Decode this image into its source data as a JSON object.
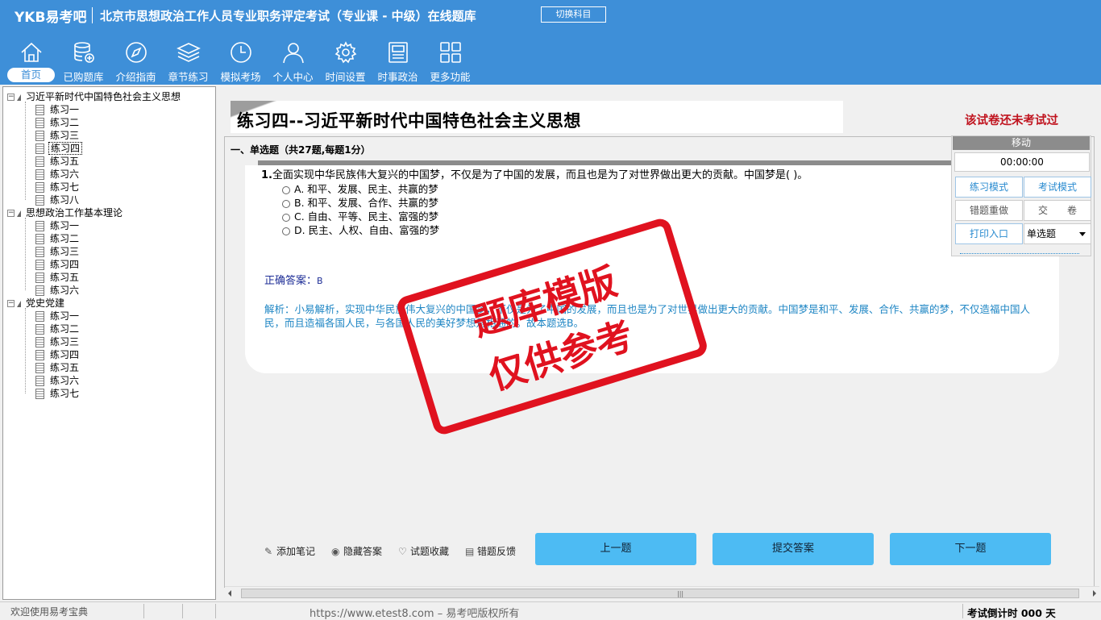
{
  "header": {
    "brand": "YKB易考吧",
    "title": "北京市思想政治工作人员专业职务评定考试（专业课 - 中级）在线题库",
    "switch_label": "切换科目",
    "nav": [
      {
        "label": "首页",
        "icon": "home-icon",
        "active": true
      },
      {
        "label": "已购题库",
        "icon": "database-add-icon"
      },
      {
        "label": "介绍指南",
        "icon": "compass-icon"
      },
      {
        "label": "章节练习",
        "icon": "layers-icon"
      },
      {
        "label": "模拟考场",
        "icon": "clock-icon"
      },
      {
        "label": "个人中心",
        "icon": "user-icon"
      },
      {
        "label": "时间设置",
        "icon": "gear-icon"
      },
      {
        "label": "时事政治",
        "icon": "news-icon"
      },
      {
        "label": "更多功能",
        "icon": "grid-icon"
      }
    ]
  },
  "tree": {
    "groups": [
      {
        "label": "习近平新时代中国特色社会主义思想",
        "items": [
          "练习一",
          "练习二",
          "练习三",
          "练习四",
          "练习五",
          "练习六",
          "练习七",
          "练习八"
        ],
        "selected": 3
      },
      {
        "label": "思想政治工作基本理论",
        "items": [
          "练习一",
          "练习二",
          "练习三",
          "练习四",
          "练习五",
          "练习六"
        ]
      },
      {
        "label": "党史党建",
        "items": [
          "练习一",
          "练习二",
          "练习三",
          "练习四",
          "练习五",
          "练习六",
          "练习七"
        ]
      }
    ]
  },
  "paper": {
    "title": "练习四--习近平新时代中国特色社会主义思想",
    "status": "该试卷还未考试过",
    "section": "一、单选题（共27题,每题1分）",
    "question": {
      "number": "1.",
      "text": "全面实现中华民族伟大复兴的中国梦，不仅是为了中国的发展，而且也是为了对世界做出更大的贡献。中国梦是( )。",
      "options": [
        "A. 和平、发展、民主、共赢的梦",
        "B. 和平、发展、合作、共赢的梦",
        "C. 自由、平等、民主、富强的梦",
        "D. 民主、人权、自由、富强的梦"
      ],
      "answer_label": "正确答案：",
      "answer": "B",
      "analysis": "解析：小易解析，实现中华民族伟大复兴的中国梦，不仅是为了中国的发展，而且也是为了对世界做出更大的贡献。中国梦是和平、发展、合作、共赢的梦，不仅造福中国人民，而且造福各国人民，与各国人民的美好梦想是相通的。故本题选B。"
    },
    "watermark": [
      "题库模版",
      "仅供参考"
    ]
  },
  "float_panel": {
    "move_label": "移动",
    "timer": "00:00:00",
    "practice_mode": "练习模式",
    "exam_mode": "考试模式",
    "redo_wrong": "错题重做",
    "submit_paper": "交　　卷",
    "print_entry": "打印入口",
    "type_select": "单选题"
  },
  "tools": {
    "add_note": "添加笔记",
    "hide_answer": "隐藏答案",
    "favorite": "试题收藏",
    "report_error": "错题反馈",
    "prev": "上一题",
    "submit": "提交答案",
    "next": "下一题"
  },
  "status_bar": {
    "welcome": "欢迎使用易考宝典",
    "copyright": "https://www.etest8.com – 易考吧版权所有",
    "countdown": "考试倒计时 000 天"
  },
  "colors": {
    "header": "#3e8fd8",
    "accent_button": "#4dbbf3",
    "status_red": "#c0141f",
    "answer_blue": "#1d2d96",
    "analysis_blue": "#1f86c4"
  }
}
